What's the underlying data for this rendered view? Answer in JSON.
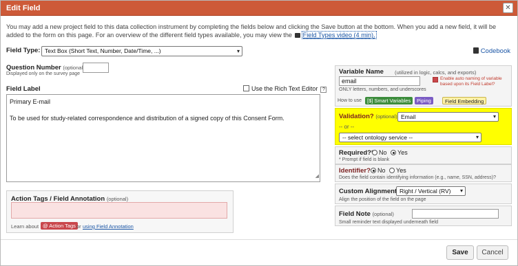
{
  "dialog": {
    "title": "Edit Field",
    "close_icon": "close-icon",
    "intro": "You may add a new project field to this data collection instrument by completing the fields below and clicking the Save button at the bottom. When you add a new field, it will be added to the form on this page. For an overview of the different field types available, you may view the",
    "intro_link": "Field Types video (4 min).",
    "video_icon": "film-icon"
  },
  "field_type": {
    "label": "Field Type:",
    "value": "Text Box (Short Text, Number, Date/Time, ...)"
  },
  "codebook": {
    "label": "Codebook",
    "icon": "book-icon"
  },
  "question_number": {
    "label": "Question Number",
    "optional": "(optional)",
    "hint": "Displayed only on the survey page",
    "value": ""
  },
  "field_label": {
    "label": "Field Label",
    "rte_label": "Use the Rich Text Editor",
    "help": "?",
    "line1": "Primary E-mail",
    "line2": "To be used for study-related correspondence and distribution of a signed copy of this Consent Form."
  },
  "variable_name": {
    "label": "Variable Name",
    "hint_inline": "(utilized in logic, calcs, and exports)",
    "value": "email",
    "hint": "ONLY letters, numbers, and underscores",
    "auto_naming": "Enable auto naming of variable based upon its Field Label?",
    "how_to_use": "How to use",
    "tags": [
      "[$] Smart Variables",
      "Piping",
      "Field Embedding"
    ]
  },
  "validation": {
    "label": "Validation?",
    "optional": "(optional)",
    "value": "Email",
    "or": "-- or --",
    "ontology": "-- select ontology service --"
  },
  "required": {
    "label": "Required?*",
    "no": "No",
    "yes": "Yes",
    "hint": "* Prompt if field is blank"
  },
  "identifier": {
    "label": "Identifier?",
    "no": "No",
    "yes": "Yes",
    "hint": "Does the field contain identifying information (e.g., name, SSN, address)?"
  },
  "alignment": {
    "label": "Custom Alignment",
    "value": "Right / Vertical (RV)",
    "hint": "Align the position of the field on the page"
  },
  "field_note": {
    "label": "Field Note",
    "optional": "(optional)",
    "hint": "Small reminder text displayed underneath field",
    "value": ""
  },
  "action_tags": {
    "label": "Action Tags / Field Annotation",
    "optional": "(optional)",
    "learn": "Learn about",
    "tag_button": "@ Action Tags",
    "or": "or",
    "link": "using Field Annotation"
  },
  "footer": {
    "save": "Save",
    "cancel": "Cancel"
  },
  "colors": {
    "title_bar": "#cd5a38",
    "highlight": "#ffff00",
    "smart_var": "#3c8c3c",
    "piping": "#7b5cc4",
    "embedding": "#fff2a8",
    "action_tag": "#c9474c"
  }
}
